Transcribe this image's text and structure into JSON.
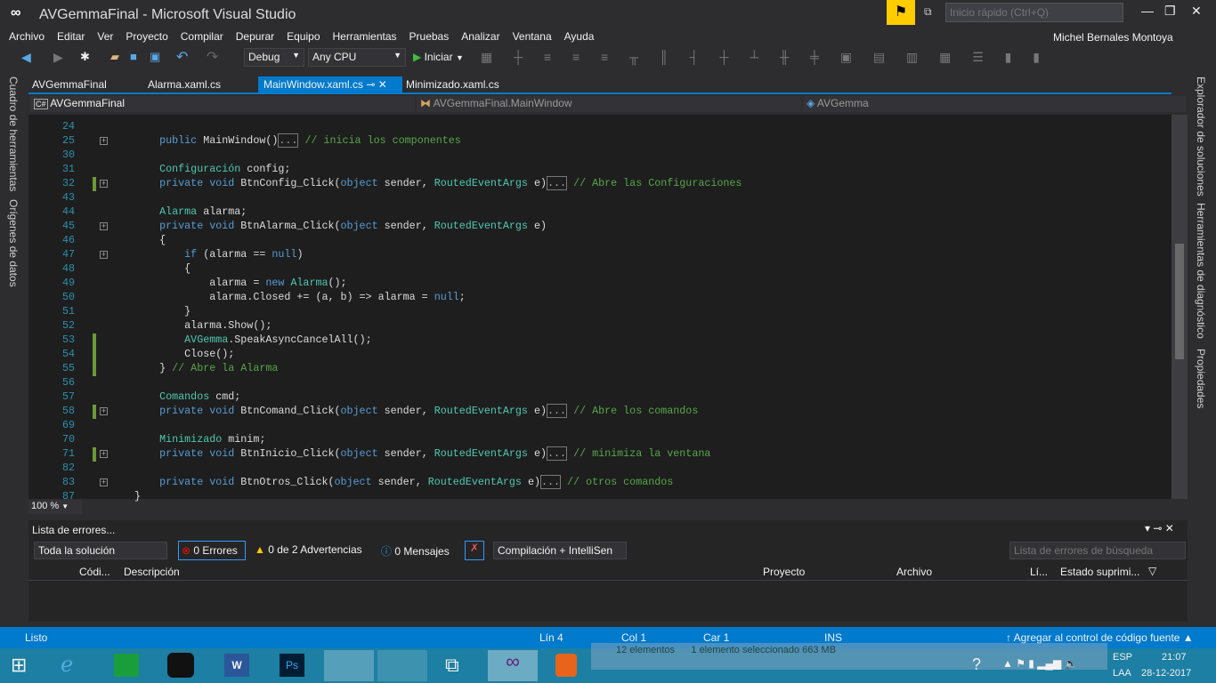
{
  "window": {
    "title": "AVGemmaFinal - Microsoft Visual Studio",
    "quick_launch_placeholder": "Inicio rápido (Ctrl+Q)",
    "user": "Michel Bernales Montoya"
  },
  "menu": [
    "Archivo",
    "Editar",
    "Ver",
    "Proyecto",
    "Compilar",
    "Depurar",
    "Equipo",
    "Herramientas",
    "Pruebas",
    "Analizar",
    "Ventana",
    "Ayuda"
  ],
  "toolbar": {
    "config": "Debug",
    "platform": "Any CPU",
    "start": "Iniciar"
  },
  "tabs": [
    {
      "label": "AVGemmaFinal",
      "active": false
    },
    {
      "label": "Alarma.xaml.cs",
      "active": false
    },
    {
      "label": "MainWindow.xaml.cs",
      "active": true
    },
    {
      "label": "Minimizado.xaml.cs",
      "active": false
    }
  ],
  "nav": {
    "project": "AVGemmaFinal",
    "class": "AVGemmaFinal.MainWindow",
    "member": "AVGemma"
  },
  "left_sidebar": [
    "Cuadro de herramientas",
    "Orígenes de datos"
  ],
  "right_sidebar": [
    "Explorador de soluciones",
    "Herramientas de diagnóstico",
    "Propiedades"
  ],
  "code_lines": [
    {
      "n": "24",
      "t": []
    },
    {
      "n": "25",
      "fold": true,
      "t": [
        [
          "",
          "        "
        ],
        [
          "k",
          "public"
        ],
        [
          "",
          " MainWindow()"
        ],
        [
          "col",
          "..."
        ],
        [
          "",
          " "
        ],
        [
          "c",
          "// inicia los componentes"
        ]
      ]
    },
    {
      "n": "30",
      "t": []
    },
    {
      "n": "31",
      "t": [
        [
          "",
          "        "
        ],
        [
          "t",
          "Configuración"
        ],
        [
          "",
          " config;"
        ]
      ]
    },
    {
      "n": "32",
      "fold": true,
      "chg": true,
      "t": [
        [
          "",
          "        "
        ],
        [
          "k",
          "private void"
        ],
        [
          "",
          " BtnConfig_Click("
        ],
        [
          "k",
          "object"
        ],
        [
          "",
          " sender, "
        ],
        [
          "t",
          "RoutedEventArgs"
        ],
        [
          "",
          " e)"
        ],
        [
          "col",
          "..."
        ],
        [
          "",
          " "
        ],
        [
          "c",
          "// Abre las Configuraciones"
        ]
      ]
    },
    {
      "n": "43",
      "t": []
    },
    {
      "n": "44",
      "t": [
        [
          "",
          "        "
        ],
        [
          "t",
          "Alarma"
        ],
        [
          "",
          " alarma;"
        ]
      ]
    },
    {
      "n": "45",
      "fold": true,
      "t": [
        [
          "",
          "        "
        ],
        [
          "k",
          "private void"
        ],
        [
          "",
          " BtnAlarma_Click("
        ],
        [
          "k",
          "object"
        ],
        [
          "",
          " sender, "
        ],
        [
          "t",
          "RoutedEventArgs"
        ],
        [
          "",
          " e)"
        ]
      ]
    },
    {
      "n": "46",
      "t": [
        [
          "",
          "        {"
        ]
      ]
    },
    {
      "n": "47",
      "fold": true,
      "t": [
        [
          "",
          "            "
        ],
        [
          "k",
          "if"
        ],
        [
          "",
          " (alarma == "
        ],
        [
          "k",
          "null"
        ],
        [
          "",
          ")"
        ]
      ]
    },
    {
      "n": "48",
      "t": [
        [
          "",
          "            {"
        ]
      ]
    },
    {
      "n": "49",
      "t": [
        [
          "",
          "                alarma = "
        ],
        [
          "k",
          "new"
        ],
        [
          "",
          " "
        ],
        [
          "t",
          "Alarma"
        ],
        [
          "",
          "();"
        ]
      ]
    },
    {
      "n": "50",
      "t": [
        [
          "",
          "                alarma.Closed += (a, b) => alarma = "
        ],
        [
          "k",
          "null"
        ],
        [
          "",
          ";"
        ]
      ]
    },
    {
      "n": "51",
      "t": [
        [
          "",
          "            }"
        ]
      ]
    },
    {
      "n": "52",
      "t": [
        [
          "",
          "            alarma.Show();"
        ]
      ]
    },
    {
      "n": "53",
      "chg": true,
      "t": [
        [
          "",
          "            "
        ],
        [
          "t",
          "AVGemma"
        ],
        [
          "",
          ".SpeakAsyncCancelAll();"
        ]
      ]
    },
    {
      "n": "54",
      "chg": true,
      "t": [
        [
          "",
          "            Close();"
        ]
      ]
    },
    {
      "n": "55",
      "chg": true,
      "t": [
        [
          "",
          "        } "
        ],
        [
          "c",
          "// Abre la Alarma"
        ]
      ]
    },
    {
      "n": "56",
      "t": []
    },
    {
      "n": "57",
      "t": [
        [
          "",
          "        "
        ],
        [
          "t",
          "Comandos"
        ],
        [
          "",
          " cmd;"
        ]
      ]
    },
    {
      "n": "58",
      "fold": true,
      "chg": true,
      "t": [
        [
          "",
          "        "
        ],
        [
          "k",
          "private void"
        ],
        [
          "",
          " BtnComand_Click("
        ],
        [
          "k",
          "object"
        ],
        [
          "",
          " sender, "
        ],
        [
          "t",
          "RoutedEventArgs"
        ],
        [
          "",
          " e)"
        ],
        [
          "col",
          "..."
        ],
        [
          "",
          " "
        ],
        [
          "c",
          "// Abre los comandos"
        ]
      ]
    },
    {
      "n": "69",
      "t": []
    },
    {
      "n": "70",
      "t": [
        [
          "",
          "        "
        ],
        [
          "t",
          "Minimizado"
        ],
        [
          "",
          " minim;"
        ]
      ]
    },
    {
      "n": "71",
      "fold": true,
      "chg": true,
      "t": [
        [
          "",
          "        "
        ],
        [
          "k",
          "private void"
        ],
        [
          "",
          " BtnInicio_Click("
        ],
        [
          "k",
          "object"
        ],
        [
          "",
          " sender, "
        ],
        [
          "t",
          "RoutedEventArgs"
        ],
        [
          "",
          " e)"
        ],
        [
          "col",
          "..."
        ],
        [
          "",
          " "
        ],
        [
          "c",
          "// minimiza la ventana"
        ]
      ]
    },
    {
      "n": "82",
      "t": []
    },
    {
      "n": "83",
      "fold": true,
      "t": [
        [
          "",
          "        "
        ],
        [
          "k",
          "private void"
        ],
        [
          "",
          " BtnOtros_Click("
        ],
        [
          "k",
          "object"
        ],
        [
          "",
          " sender, "
        ],
        [
          "t",
          "RoutedEventArgs"
        ],
        [
          "",
          " e)"
        ],
        [
          "col",
          "..."
        ],
        [
          "",
          " "
        ],
        [
          "c",
          "// otros comandos"
        ]
      ]
    },
    {
      "n": "87",
      "t": [
        [
          "",
          "    }"
        ]
      ]
    }
  ],
  "zoom": "100 %",
  "errors": {
    "title": "Lista de errores...",
    "scope": "Toda la solución",
    "errors": "0 Errores",
    "warnings": "0 de 2 Advertencias",
    "messages": "0 Mensajes",
    "build": "Compilación + IntelliSen",
    "search_placeholder": "Lista de errores de búsqueda",
    "columns": [
      "Códi...",
      "Descripción",
      "Proyecto",
      "Archivo",
      "Lí...",
      "Estado suprimi..."
    ]
  },
  "status": {
    "ready": "Listo",
    "line": "Lín 4",
    "col": "Col 1",
    "car": "Car 1",
    "mode": "INS",
    "source_control": "Agregar al control de código fuente"
  },
  "explorer_behind": {
    "items": "12 elementos",
    "selected": "1 elemento seleccionado  663 MB"
  },
  "tray": {
    "lang": "ESP",
    "layout": "LAA",
    "time": "21:07",
    "date": "28-12-2017"
  },
  "colors": {
    "accent": "#007acc",
    "keyword": "#569cd6",
    "type": "#4ec9b0",
    "comment": "#57a64a",
    "line_number": "#2b91af"
  }
}
